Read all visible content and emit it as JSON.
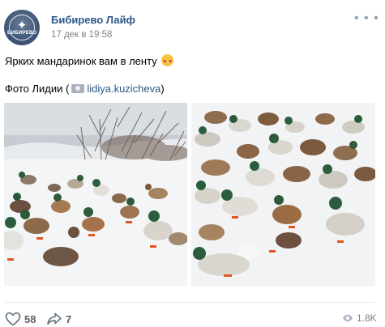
{
  "group": {
    "name": "Бибирево Лайф",
    "date": "17 дек в 19:58",
    "avatar_logo_text": "БИБИРЕВО"
  },
  "post": {
    "text": "Ярких мандаринок вам в ленту",
    "emoji": "heart-eyes-emoji",
    "credit_prefix": "Фото Лидии (",
    "credit_user": "lidiya.kuzicheva",
    "credit_suffix": ")"
  },
  "photos": [
    {
      "icon": "photo-ducks-on-snow-left"
    },
    {
      "icon": "photo-ducks-on-snow-right"
    }
  ],
  "footer": {
    "likes": "58",
    "shares": "7",
    "views": "1.8K"
  },
  "colors": {
    "link": "#2a5885",
    "muted": "#828282",
    "icon": "#6d7885"
  }
}
